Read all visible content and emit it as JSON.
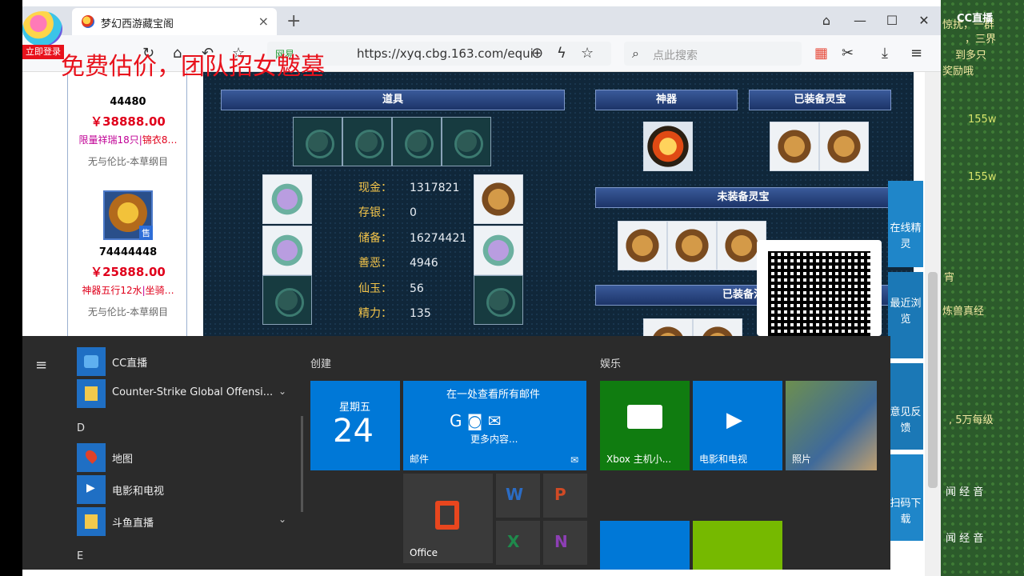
{
  "browser": {
    "tab_title": "梦幻西游藏宝阁",
    "tab_close": "×",
    "new_tab": "+",
    "url": "https://xyq.cbg.163.com/equi",
    "secure_label": "网易",
    "search_placeholder": "点此搜索"
  },
  "overlay": {
    "title": "免费估价，团队招女魃墓",
    "login_badge": "立即登录",
    "cc_logo": "CC直播"
  },
  "listings": [
    {
      "sid": "44480",
      "price": "￥38888.00",
      "desc_a": "限量祥瑞18只",
      "desc_b": "锦衣8…",
      "server": "无与伦比-本草纲目"
    },
    {
      "sid": "74444448",
      "price": "￥25888.00",
      "desc_a": "神器五行12水",
      "desc_b": "坐骑…",
      "server": "无与伦比-本草纲目",
      "badge": "售"
    }
  ],
  "game_panel": {
    "sections": {
      "items": "道具",
      "artifact": "神器",
      "equipped_lingbao": "已装备灵宝",
      "unequipped_lingbao": "未装备灵宝",
      "equipped_fa": "已装备法"
    },
    "stats": [
      {
        "k": "现金：",
        "v": "1317821"
      },
      {
        "k": "存银：",
        "v": "0"
      },
      {
        "k": "储备：",
        "v": "16274421"
      },
      {
        "k": "善恶：",
        "v": "4946"
      },
      {
        "k": "仙玉：",
        "v": "56"
      },
      {
        "k": "精力：",
        "v": "135"
      }
    ]
  },
  "sidebar": {
    "online": "在线精灵",
    "recent": "最近浏览",
    "feedback": "意见反馈",
    "scan": "扫码下载"
  },
  "start_menu": {
    "apps": [
      {
        "label": "CC直播"
      },
      {
        "label": "Counter-Strike Global Offensi...",
        "chev": "⌄"
      },
      {
        "label": "地图"
      },
      {
        "label": "电影和电视"
      },
      {
        "label": "斗鱼直播",
        "chev": "⌄"
      }
    ],
    "letters": [
      "D",
      "E"
    ],
    "groups": {
      "create": "创建",
      "entertain": "娱乐"
    },
    "tiles": {
      "calendar_day": "星期五",
      "calendar_date": "24",
      "mail_title": "在一处查看所有邮件",
      "mail_more": "更多内容...",
      "mail_label": "邮件",
      "office": "Office",
      "xbox": "Xbox 主机小...",
      "movies": "电影和电视",
      "photos": "照片"
    }
  },
  "right_game": {
    "lines": [
      "惊扰，一群",
      "，三界",
      "到多只",
      "奖励哦"
    ],
    "num1": "155w",
    "num2": "155w",
    "misc1": "宵",
    "misc2": "炼兽真经",
    "misc3": ", 5万每级",
    "menu1": "闻 经 音",
    "menu2": "闻 经 音"
  }
}
